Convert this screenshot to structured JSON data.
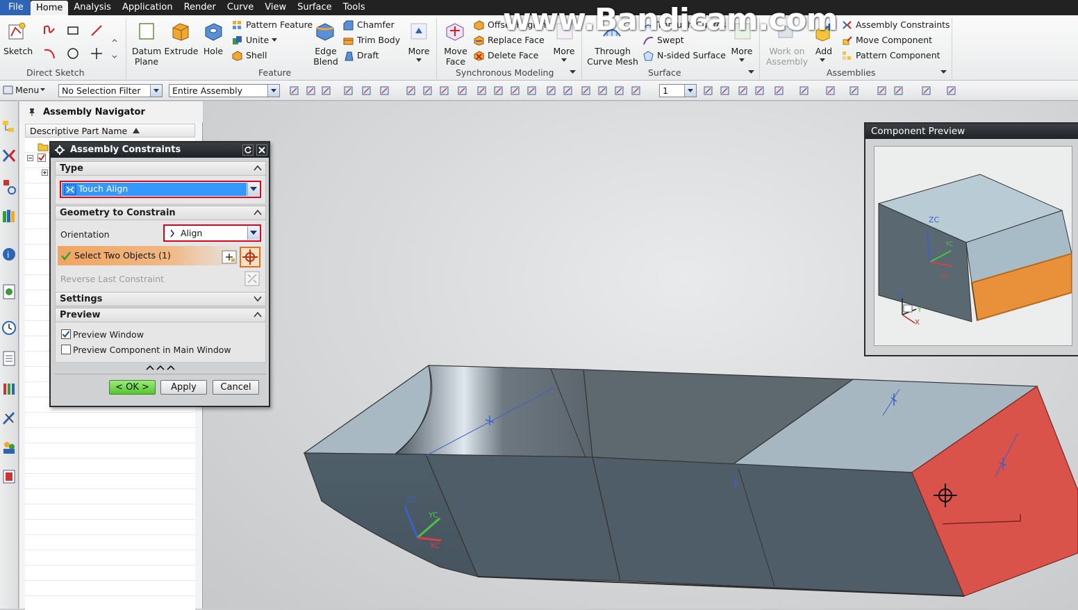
{
  "menu": {
    "items": [
      "File",
      "Home",
      "Analysis",
      "Application",
      "Render",
      "Curve",
      "View",
      "Surface",
      "Tools"
    ]
  },
  "ribbon": {
    "sketch": "Sketch",
    "group_direct_sketch": "Direct Sketch",
    "datum_plane": [
      "Datum",
      "Plane"
    ],
    "extrude": "Extrude",
    "hole": "Hole",
    "pattern_feature": "Pattern Feature",
    "unite": "Unite",
    "shell": "Shell",
    "edge_blend": [
      "Edge",
      "Blend"
    ],
    "chamfer": "Chamfer",
    "trim_body": "Trim Body",
    "draft": "Draft",
    "more": "More",
    "group_feature": "Feature",
    "move_face": [
      "Move",
      "Face"
    ],
    "offset_region": "Offset Region",
    "replace_face": "Replace Face",
    "delete_face": "Delete Face",
    "group_sync": "Synchronous Modeling",
    "through_curve_mesh": [
      "Through",
      "Curve Mesh"
    ],
    "through_curves": "Through Curves",
    "swept": "Swept",
    "n_sided_surface": "N-sided Surface",
    "group_surface": "Surface",
    "work_on_assembly": [
      "Work on",
      "Assembly"
    ],
    "add": "Add",
    "assembly_constraints": "Assembly Constraints",
    "move_component": "Move Component",
    "pattern_component": "Pattern Component",
    "group_assemblies": "Assemblies"
  },
  "toolbar": {
    "menu": "Menu",
    "selection_filter": "No Selection Filter",
    "scope": "Entire Assembly",
    "layer": "1"
  },
  "navigator": {
    "title": "Assembly Navigator",
    "column": "Descriptive Part Name"
  },
  "dialog": {
    "title": "Assembly Constraints",
    "type_section": "Type",
    "type_value": "Touch Align",
    "geometry_section": "Geometry to Constrain",
    "orientation_label": "Orientation",
    "orientation_value": "Align",
    "select_objects": "Select Two Objects (1)",
    "reverse_last": "Reverse Last Constraint",
    "settings_section": "Settings",
    "preview_section": "Preview",
    "preview_window": "Preview Window",
    "preview_window_checked": true,
    "preview_main": "Preview Component in Main Window",
    "preview_main_checked": false,
    "ok": "< OK >",
    "apply": "Apply",
    "cancel": "Cancel"
  },
  "component_preview": {
    "title": "Component Preview",
    "axis_zc": "ZC",
    "axis_yc": "YC",
    "axis_xc": "XC",
    "triad_z": "Z",
    "triad_y": "Y",
    "triad_x": "X"
  },
  "viewport": {
    "axis_zc": "ZC",
    "axis_yc": "YC",
    "axis_xc": "XC"
  },
  "watermark": "www.Bandicam.com",
  "colors": {
    "selected_face": "#d9534a",
    "preview_face": "#e8913a",
    "highlight_border": "#e0001b",
    "ok_green": "#55c531",
    "accent_blue": "#2d64b4"
  }
}
